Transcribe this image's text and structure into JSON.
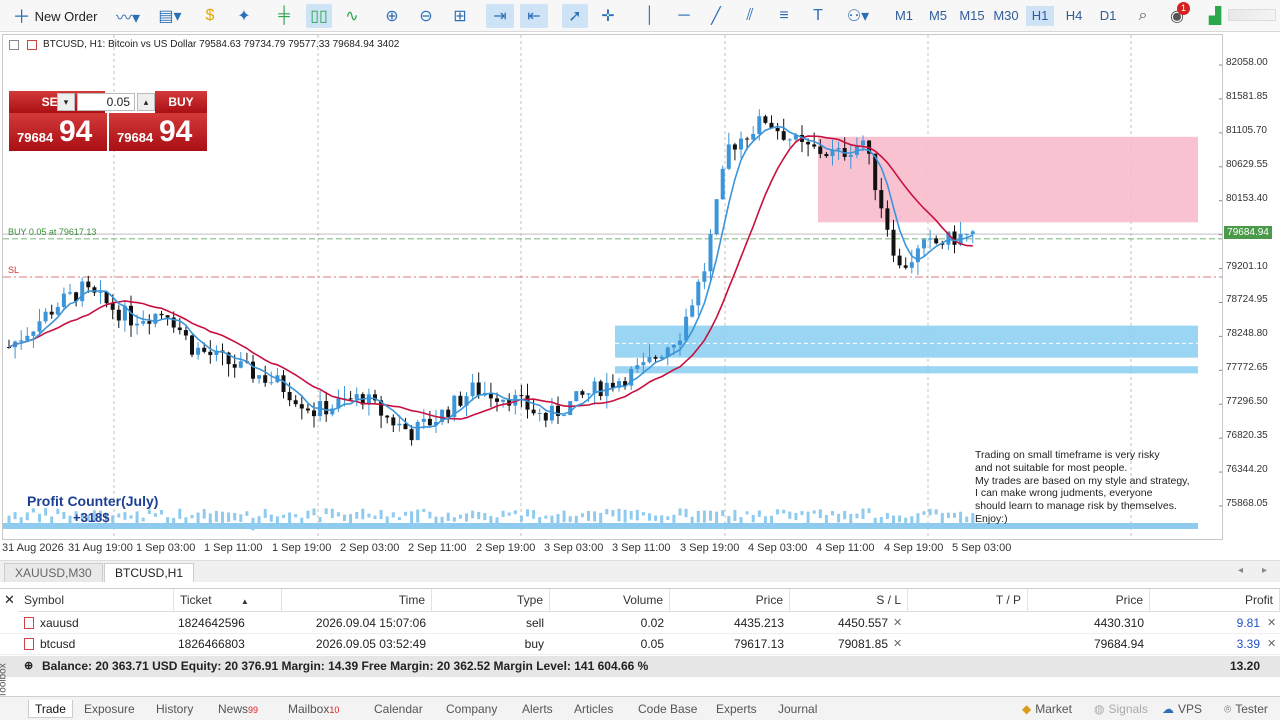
{
  "toolbar": {
    "new_order": "New Order",
    "timeframes": [
      "M1",
      "M5",
      "M15",
      "M30",
      "H1",
      "H4",
      "D1"
    ],
    "active_timeframe": "H1",
    "notification_count": "1"
  },
  "chart": {
    "header": "BTCUSD, H1:  Bitcoin vs US Dollar  79584.63 79734.79 79577.33 79684.94  3402",
    "sell_label": "SELL",
    "buy_label": "BUY",
    "lot": "0.05",
    "sell_price_small": "79684",
    "sell_price_big": "94",
    "buy_price_small": "79684",
    "buy_price_big": "94",
    "buy_line_label": "BUY 0.05 at 79617.13",
    "sl_label": "SL",
    "profit_title": "Profit Counter(July)",
    "profit_value": "+318$",
    "note": [
      "Trading on small timeframe is very risky",
      "and not suitable for most people.",
      "My trades are based on my style and strategy,",
      "I can make wrong judments, everyone",
      "should learn to manage risk by themselves.",
      "Enjoy:)"
    ],
    "price_ticks": [
      "82058.00",
      "81581.85",
      "81105.70",
      "80629.55",
      "80153.40",
      "79677.25",
      "79201.10",
      "78724.95",
      "78248.80",
      "77772.65",
      "77296.50",
      "76820.35",
      "76344.20",
      "75868.05"
    ],
    "current_price": "79684.94",
    "time_ticks": [
      "31 Aug 2026",
      "31 Aug 19:00",
      "1 Sep 03:00",
      "1 Sep 11:00",
      "1 Sep 19:00",
      "2 Sep 03:00",
      "2 Sep 11:00",
      "2 Sep 19:00",
      "3 Sep 03:00",
      "3 Sep 11:00",
      "3 Sep 19:00",
      "4 Sep 03:00",
      "4 Sep 11:00",
      "4 Sep 19:00",
      "5 Sep 03:00"
    ],
    "colors": {
      "bull": "#3b95d8",
      "bear": "#111111",
      "ma_fast": "#3b95d8",
      "ma_slow": "#c8103f",
      "supply": "#f7b7c8",
      "demand": "#8fd0f2",
      "sell_red": "#c0141b"
    }
  },
  "chart_tabs": [
    "XAUUSD,M30",
    "BTCUSD,H1"
  ],
  "active_chart_tab": "BTCUSD,H1",
  "terminal": {
    "columns": [
      "Symbol",
      "Ticket",
      "Time",
      "Type",
      "Volume",
      "Price",
      "S / L",
      "T / P",
      "Price",
      "Profit"
    ],
    "rows": [
      {
        "symbol": "xauusd",
        "ticket": "1824642596",
        "time": "2026.09.04 15:07:06",
        "type": "sell",
        "volume": "0.02",
        "price": "4435.213",
        "sl": "4450.557",
        "tp": "",
        "cur": "4430.310",
        "profit": "9.81"
      },
      {
        "symbol": "btcusd",
        "ticket": "1826466803",
        "time": "2026.09.05 03:52:49",
        "type": "buy",
        "volume": "0.05",
        "price": "79617.13",
        "sl": "79081.85",
        "tp": "",
        "cur": "79684.94",
        "profit": "3.39"
      }
    ],
    "balance_line": "Balance: 20 363.71 USD  Equity: 20 376.91  Margin: 14.39  Free Margin: 20 362.52  Margin Level: 141 604.66 %",
    "total_profit": "13.20"
  },
  "bottom_tabs": [
    {
      "label": "Trade",
      "badge": ""
    },
    {
      "label": "Exposure",
      "badge": ""
    },
    {
      "label": "History",
      "badge": ""
    },
    {
      "label": "News",
      "badge": "99"
    },
    {
      "label": "Mailbox",
      "badge": "10"
    },
    {
      "label": "Calendar",
      "badge": ""
    },
    {
      "label": "Company",
      "badge": ""
    },
    {
      "label": "Alerts",
      "badge": ""
    },
    {
      "label": "Articles",
      "badge": ""
    },
    {
      "label": "Code Base",
      "badge": ""
    },
    {
      "label": "Experts",
      "badge": ""
    },
    {
      "label": "Journal",
      "badge": ""
    }
  ],
  "status_right": {
    "market": "Market",
    "signals": "Signals",
    "vps": "VPS",
    "tester": "Tester"
  },
  "toolbox_label": "Toolbox"
}
